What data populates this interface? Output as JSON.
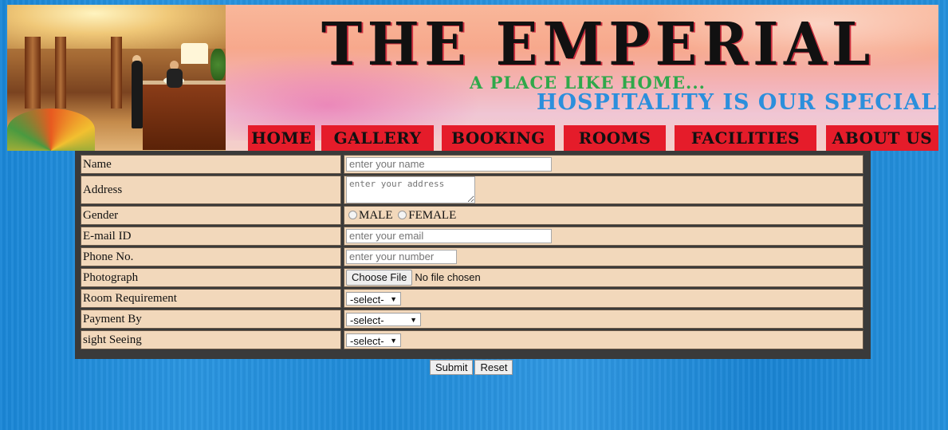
{
  "header": {
    "title": "THE EMPERIAL",
    "tagline": "A PLACE LIKE HOME...",
    "slogan": "HOSPITALITY IS OUR SPECIALITY"
  },
  "nav": [
    {
      "label": "HOME"
    },
    {
      "label": "GALLERY"
    },
    {
      "label": "BOOKING"
    },
    {
      "label": "ROOMS"
    },
    {
      "label": "FACILITIES"
    },
    {
      "label": "ABOUT US"
    }
  ],
  "form": {
    "name": {
      "label": "Name",
      "placeholder": "enter your name",
      "value": ""
    },
    "address": {
      "label": "Address",
      "placeholder": "enter your address",
      "value": ""
    },
    "gender": {
      "label": "Gender",
      "options": [
        "MALE",
        "FEMALE"
      ],
      "selected": ""
    },
    "email": {
      "label": "E-mail ID",
      "placeholder": "enter your email",
      "value": ""
    },
    "phone": {
      "label": "Phone No.",
      "placeholder": "enter your number",
      "value": ""
    },
    "photo": {
      "label": "Photograph",
      "button": "Choose File",
      "status": "No file chosen"
    },
    "room": {
      "label": "Room Requirement",
      "selected": "-select-"
    },
    "payment": {
      "label": "Payment By",
      "selected": "-select-"
    },
    "sightseeing": {
      "label": "sight Seeing",
      "selected": "-select-"
    }
  },
  "buttons": {
    "submit": "Submit",
    "reset": "Reset"
  },
  "colors": {
    "background": "#1f8ad8",
    "nav_bg": "#e51c2a",
    "form_cell": "#f2d8bb",
    "tagline": "#2fa84a",
    "slogan": "#2c8fdc"
  }
}
